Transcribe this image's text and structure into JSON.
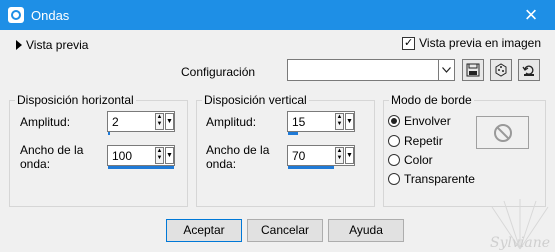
{
  "window": {
    "title": "Ondas",
    "close_glyph": "×"
  },
  "preview": {
    "toggle_label": "Vista previa",
    "image_checkbox_label": "Vista previa en imagen",
    "image_checkbox_checked": true
  },
  "config": {
    "label": "Configuración",
    "value": ""
  },
  "horizontal": {
    "group_label": "Disposición horizontal",
    "amplitude_label": "Amplitud:",
    "amplitude_value": "2",
    "amplitude_fill": 0.02,
    "width_label_line1": "Ancho de la",
    "width_label_line2": "onda:",
    "width_value": "100",
    "width_fill": 1.0
  },
  "vertical": {
    "group_label": "Disposición vertical",
    "amplitude_label": "Amplitud:",
    "amplitude_value": "15",
    "amplitude_fill": 0.15,
    "width_label_line1": "Ancho de la",
    "width_label_line2": "onda:",
    "width_value": "70",
    "width_fill": 0.7
  },
  "edge_mode": {
    "group_label": "Modo de borde",
    "options": [
      "Envolver",
      "Repetir",
      "Color",
      "Transparente"
    ],
    "selected": "Envolver"
  },
  "buttons": {
    "ok": "Aceptar",
    "cancel": "Cancelar",
    "help": "Ayuda"
  },
  "watermark": "Sylviane",
  "colors": {
    "titlebar": "#1e8fe6",
    "accent_bar": "#1f7ad6"
  }
}
